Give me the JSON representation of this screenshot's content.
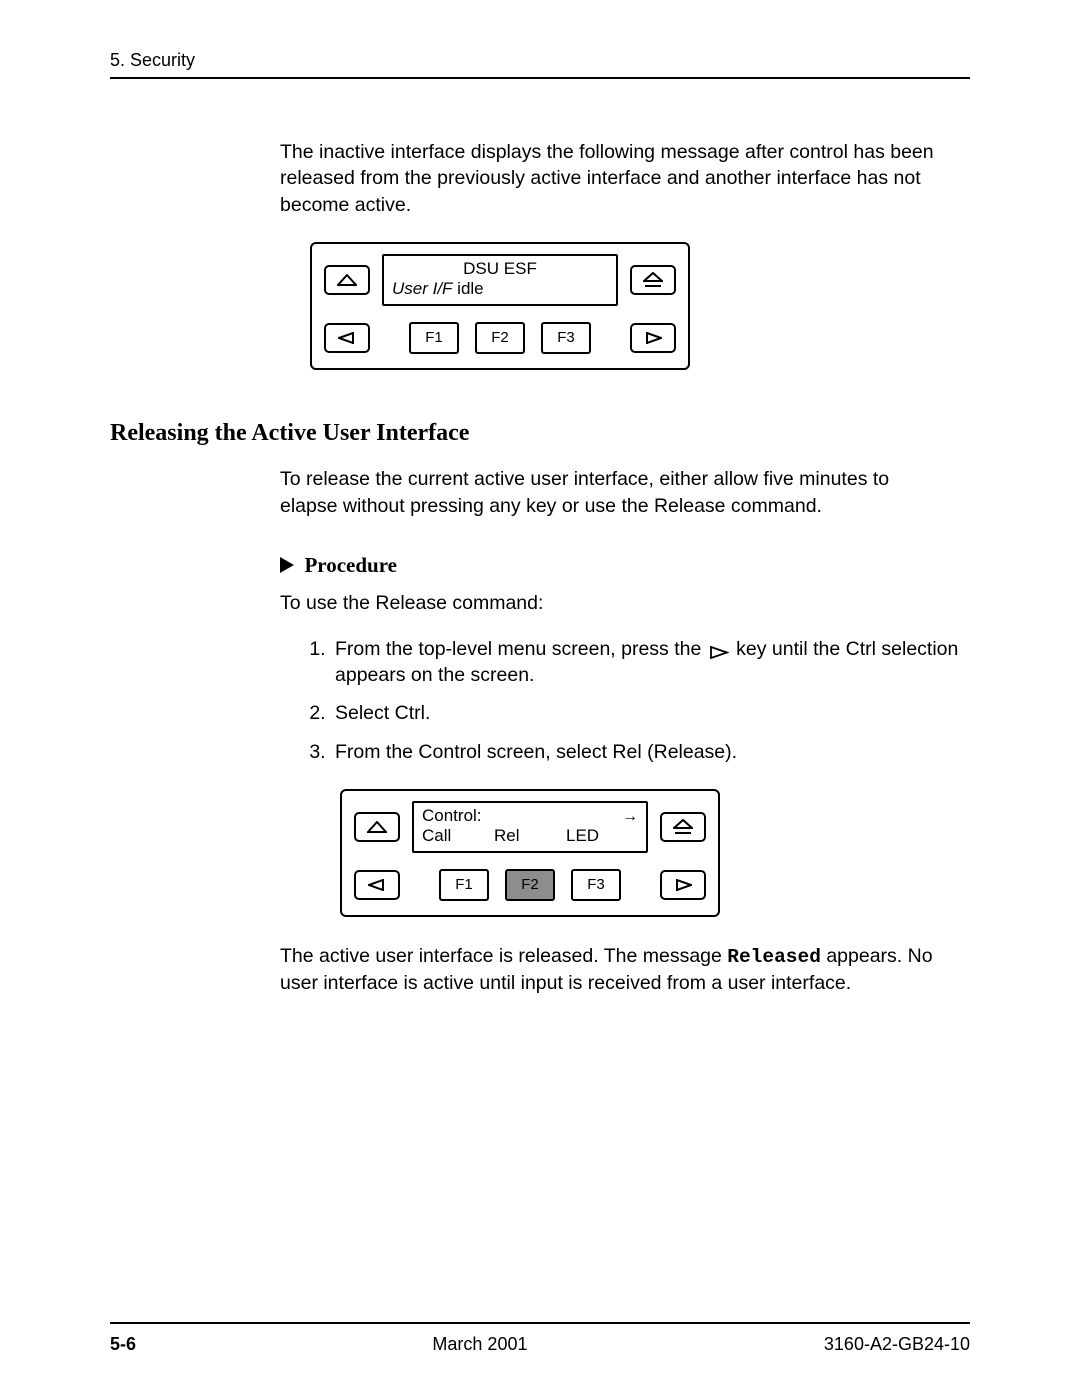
{
  "header": {
    "section": "5. Security"
  },
  "intro": "The inactive interface displays the following message after control has been released from the previously active interface and another interface has not become active.",
  "device1": {
    "line1_center": "DSU ESF",
    "line2_italic": "User I/F",
    "line2_rest": " idle",
    "fkeys": [
      "F1",
      "F2",
      "F3"
    ]
  },
  "section_title": "Releasing the Active User Interface",
  "release_intro": "To release the current active user interface, either allow five minutes to elapse without pressing any key or use the Release command.",
  "procedure_label": "Procedure",
  "procedure_intro": "To use the Release command:",
  "steps": {
    "s1a": "From the top-level menu screen, press the ",
    "s1b": " key until the Ctrl selection appears on the screen.",
    "s2": "Select Ctrl.",
    "s3": "From the Control screen, select Rel (Release)."
  },
  "device2": {
    "line1": "Control:",
    "cols": [
      "Call",
      "Rel",
      "LED"
    ],
    "fkeys": [
      "F1",
      "F2",
      "F3"
    ],
    "highlight_index": 1
  },
  "closing": {
    "a": "The active user interface is released. The message ",
    "kw": "Released",
    "b": " appears. No user interface is active until input is received from a user interface."
  },
  "footer": {
    "page": "5-6",
    "date": "March 2001",
    "docnum": "3160-A2-GB24-10"
  }
}
